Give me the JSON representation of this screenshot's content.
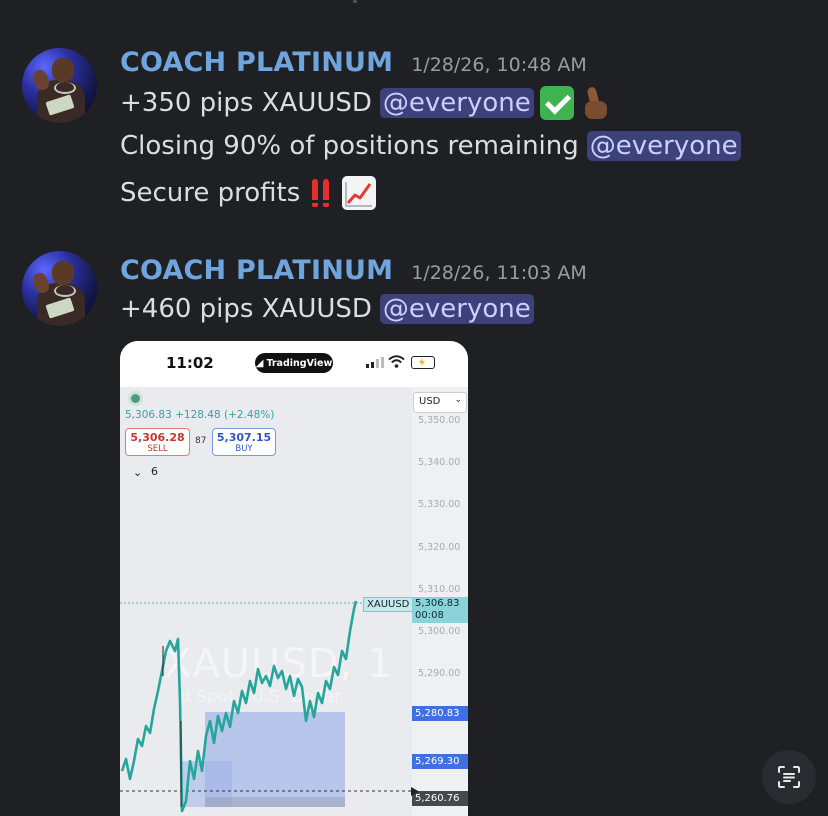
{
  "messages": [
    {
      "author": "COACH PLATINUM",
      "timestamp": "1/28/26, 10:48 AM",
      "lines": [
        {
          "text": "+350 pips XAUUSD",
          "mention": "@everyone"
        },
        {
          "text": "Closing 90% of positions remaining",
          "mention": "@everyone"
        },
        {
          "text": "Secure profits"
        }
      ]
    },
    {
      "author": "COACH PLATINUM",
      "timestamp": "1/28/26, 11:03 AM",
      "lines": [
        {
          "text": "+460 pips XAUUSD",
          "mention": "@everyone"
        }
      ]
    }
  ],
  "screenshot": {
    "status_time": "11:02",
    "app_brand": "TradingView",
    "currency_select": "USD",
    "quote_line": "5,306.83 +128.48 (+2.48%)",
    "sell": {
      "price": "5,306.28",
      "label": "SELL"
    },
    "spread": "87",
    "buy": {
      "price": "5,307.15",
      "label": "BUY"
    },
    "indicator_count": "6",
    "watermark_symbol": "XAUUSD, 1",
    "watermark_sub": "d Spot / U.S. Dollar",
    "price_axis_labels": [
      "5,350.00",
      "5,340.00",
      "5,330.00",
      "5,320.00",
      "5,310.00",
      "5,300.00",
      "5,290.00"
    ],
    "symbol_tag": "XAUUSD",
    "current_price": "5,306.83",
    "countdown": "00:08",
    "level_a": "5,280.83",
    "level_b": "5,269.30",
    "level_c": "5,260.76"
  },
  "colors": {
    "background": "#1f2024",
    "username": "#6fa4dd",
    "mention_bg": "#3c417a",
    "candle_teal": "#26a69a",
    "position_box": "#9fb2ea"
  },
  "icons": [
    "check-mark-button-icon",
    "crossed-fingers-icon",
    "double-exclamation-icon",
    "chart-increasing-icon",
    "text-scan-icon"
  ]
}
